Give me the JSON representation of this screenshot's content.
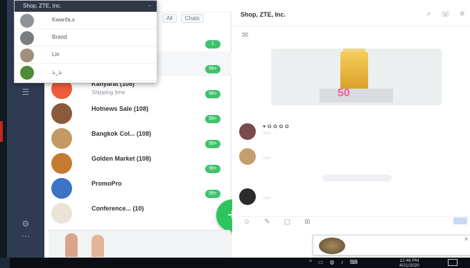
{
  "window": {
    "title": "Shop, ZTE, Inc."
  },
  "account_menu": {
    "header": "Shop, ZTE, Inc.",
    "items": [
      {
        "label": "Kwanfa.s",
        "color": "#8f9397"
      },
      {
        "label": "Brand",
        "color": "#7a7d80"
      },
      {
        "label": "Lin",
        "color": "#a08f7a"
      },
      {
        "label": "ঌ_ঌ",
        "color": "#4f8a35"
      }
    ]
  },
  "chat_list": {
    "tabs": [
      "All",
      "Chats"
    ],
    "chats": [
      {
        "name": "Ⓣ",
        "preview": "",
        "time": "",
        "badge": "1",
        "color": "#c9d0d8"
      },
      {
        "name": "",
        "preview": "",
        "time": "",
        "badge": "",
        "color": "#eceef1"
      },
      {
        "name": "Kanyarat (108)",
        "preview": "Shipping time",
        "time": "",
        "badge": "",
        "color": "#ef5b3c"
      },
      {
        "name": "",
        "preview": "",
        "time": "",
        "badge": "",
        "color": "#eceef1"
      },
      {
        "name": "Hotnews Sale (108)",
        "preview": "",
        "time": "",
        "badge": "",
        "color": "#8a5a3a"
      },
      {
        "name": "Bangkok Col... (108)",
        "preview": "",
        "time": "",
        "badge": "",
        "color": "#c49a64"
      },
      {
        "name": "Golden Market (108)",
        "preview": "",
        "time": "",
        "badge": "",
        "color": "#c57a2f"
      },
      {
        "name": "PromoPro",
        "preview": "",
        "time": "",
        "badge": "",
        "color": "#3b74c6"
      },
      {
        "name": "Conference... (10)",
        "preview": "",
        "time": "",
        "badge": "",
        "color": "#e9e4d6"
      }
    ],
    "badge_counts": [
      "1",
      "99+",
      "99+",
      "99+",
      "99+",
      "99+",
      "99+"
    ]
  },
  "fab": {
    "label": "+"
  },
  "ad_banner": {
    "text": ""
  },
  "conversation": {
    "title": "Shop, ZTE, Inc.",
    "notice_line1": "",
    "notice_line2": "",
    "product_price": "50",
    "tags": [
      "",
      "",
      "",
      "",
      ""
    ],
    "messages": [
      {
        "who": "♥ ✿ ✿ ✿ ✿",
        "text": "",
        "time": "",
        "color": "#7b4a4a"
      },
      {
        "who": "",
        "text": "",
        "time": "",
        "color": "#c49f6d"
      },
      {
        "who": "",
        "text": "",
        "time": "",
        "color": "#2b2b2b"
      }
    ],
    "date_separator": ""
  },
  "toast": {
    "title": "",
    "subtitle": ""
  },
  "taskbar": {
    "time": "12:46 PM",
    "date": "4/21/2020"
  }
}
